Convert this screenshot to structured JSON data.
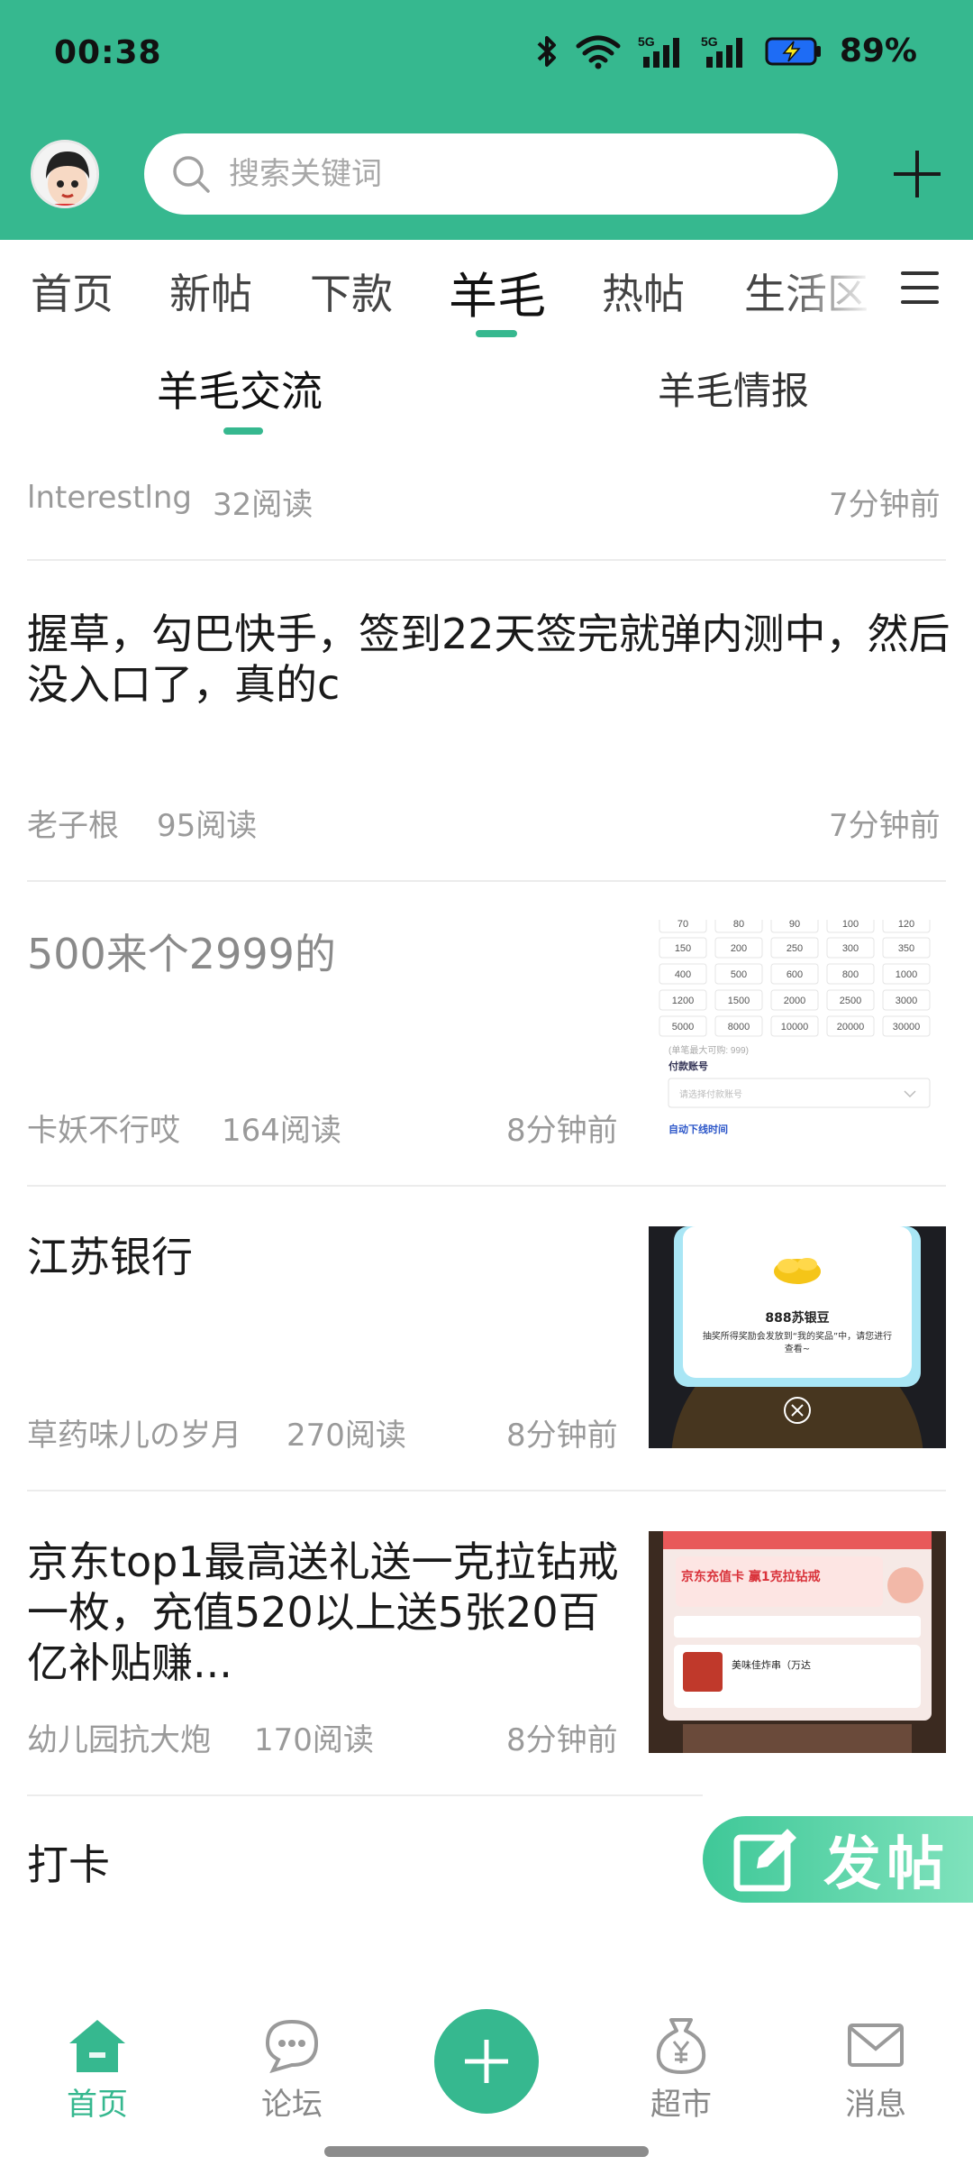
{
  "status_bar": {
    "time": "00:38",
    "battery": "89%",
    "signal_label_1": "5G",
    "signal_label_2": "5G"
  },
  "search": {
    "placeholder": "搜索关键词"
  },
  "category_tabs": [
    {
      "label": "首页"
    },
    {
      "label": "新帖"
    },
    {
      "label": "下款"
    },
    {
      "label": "羊毛",
      "active": true
    },
    {
      "label": "热帖"
    },
    {
      "label": "生活区"
    }
  ],
  "sub_tabs": [
    {
      "label": "羊毛交流",
      "active": true
    },
    {
      "label": "羊毛情报"
    }
  ],
  "posts": [
    {
      "author": "lnterestlng",
      "reads": "32阅读",
      "time": "7分钟前"
    },
    {
      "title": "握草，勾巴快手，签到22天签完就弹内测中，然后没入口了，真的c",
      "author": "老子根",
      "reads": "95阅读",
      "time": "7分钟前"
    },
    {
      "title": "500来个2999的",
      "author": "卡妖不行哎",
      "reads": "164阅读",
      "time": "8分钟前",
      "thumb": {
        "grid": [
          [
            "70",
            "80",
            "90",
            "100",
            "120"
          ],
          [
            "150",
            "200",
            "250",
            "300",
            "350"
          ],
          [
            "400",
            "500",
            "600",
            "800",
            "1000"
          ],
          [
            "1200",
            "1500",
            "2000",
            "2500",
            "3000"
          ],
          [
            "5000",
            "8000",
            "10000",
            "20000",
            "30000"
          ]
        ],
        "max_note": "(单笔最大可购: 999)",
        "pay_label": "付款账号",
        "pay_placeholder": "请选择付款账号",
        "auto_label": "自动下线时间"
      }
    },
    {
      "title": "江苏银行",
      "author": "草药味儿の岁月",
      "reads": "270阅读",
      "time": "8分钟前",
      "thumb": {
        "prize": "888苏银豆",
        "note": "抽奖所得奖励会发放到“我的奖品”中，请您进行查看~"
      }
    },
    {
      "title": "京东top1最高送礼送一克拉钻戒一枚，充值520以上送5张20百亿补贴赚...",
      "author": "幼儿园抗大炮",
      "reads": "170阅读",
      "time": "8分钟前",
      "thumb": {
        "headline": "京东充值卡 赢1克拉钻戒",
        "item": "美味佳炸串（万达"
      }
    },
    {
      "title": "打卡",
      "author": "",
      "reads": "",
      "time": ""
    }
  ],
  "fab_post_label": "发帖",
  "bottom_nav": [
    {
      "label": "首页",
      "icon": "home-icon",
      "active": true
    },
    {
      "label": "论坛",
      "icon": "chat-icon"
    },
    {
      "label": "",
      "icon": "plus-icon"
    },
    {
      "label": "超市",
      "icon": "money-bag-icon"
    },
    {
      "label": "消息",
      "icon": "mail-icon"
    }
  ],
  "colors": {
    "brand": "#36b88f",
    "meta_text": "#9a9a9a"
  }
}
